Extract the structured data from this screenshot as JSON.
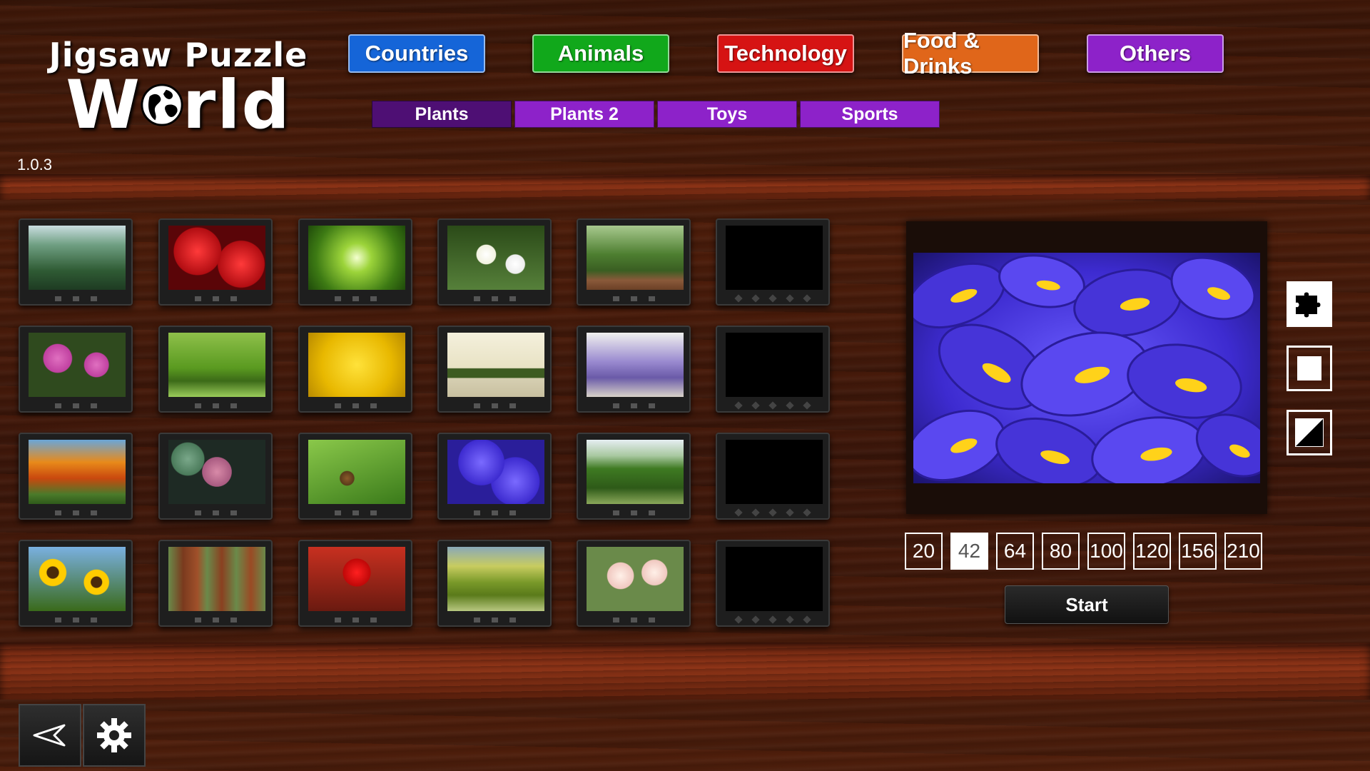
{
  "logo": {
    "line1": "Jigsaw Puzzle",
    "line2_before": "W",
    "line2_after": "rld",
    "globe_icon": "globe-icon"
  },
  "version": "1.0.3",
  "categories": [
    {
      "label": "Countries",
      "color": "#1565d8"
    },
    {
      "label": "Animals",
      "color": "#11a81b"
    },
    {
      "label": "Technology",
      "color": "#d61313"
    },
    {
      "label": "Food & Drinks",
      "color": "#e0661a"
    },
    {
      "label": "Others",
      "color": "#8d22c9"
    }
  ],
  "subcategories": [
    {
      "label": "Plants",
      "selected": true
    },
    {
      "label": "Plants 2",
      "selected": false
    },
    {
      "label": "Toys",
      "selected": false
    },
    {
      "label": "Sports",
      "selected": false
    }
  ],
  "puzzles": [
    [
      "forest",
      "red-roses",
      "treetops",
      "white-lilies",
      "large-tree",
      "empty"
    ],
    [
      "pink-anemones",
      "willow-tree",
      "yellow-flowers",
      "bonsai-trees",
      "lavender",
      "empty"
    ],
    [
      "autumn-trees",
      "succulents",
      "chestnut-leaves",
      "blue-irises",
      "tree-row",
      "empty"
    ],
    [
      "sunflowers",
      "sequoias",
      "red-poppy",
      "park-trees",
      "orchids",
      "empty"
    ]
  ],
  "selected_puzzle": "blue-irises",
  "piece_shapes": {
    "jigsaw": "puzzle-piece-icon",
    "square": "square-icon",
    "triangle": "triangle-icon",
    "selected": "jigsaw"
  },
  "piece_counts": [
    "20",
    "42",
    "64",
    "80",
    "100",
    "120",
    "156",
    "210"
  ],
  "selected_piece_count": "42",
  "start_label": "Start",
  "bottom_bar": {
    "back_icon": "back-arrow-icon",
    "settings_icon": "gear-icon"
  }
}
